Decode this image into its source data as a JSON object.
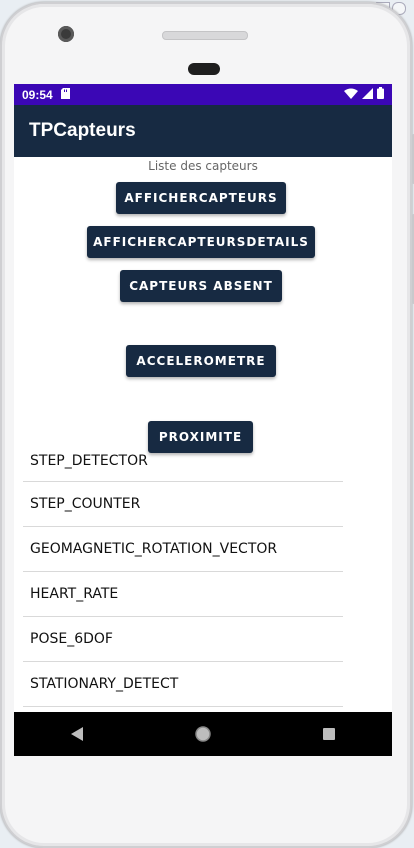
{
  "status_bar": {
    "time": "09:54"
  },
  "app": {
    "title": "TPCapteurs"
  },
  "main": {
    "caption": "Liste des capteurs",
    "buttons": {
      "afficher_capteurs": "AFFICHERCAPTEURS",
      "afficher_details": "AFFICHERCAPTEURSDETAILS",
      "capteurs_absent": "CAPTEURS ABSENT",
      "accelerometre": "ACCELEROMETRE",
      "proximite": "PROXIMITE"
    },
    "sensors": [
      "STEP_DETECTOR",
      "STEP_COUNTER",
      "GEOMAGNETIC_ROTATION_VECTOR",
      "HEART_RATE",
      "POSE_6DOF",
      "STATIONARY_DETECT"
    ]
  },
  "colors": {
    "status_bar": "#3b07b5",
    "app_bar": "#172a42",
    "button": "#172a42"
  }
}
